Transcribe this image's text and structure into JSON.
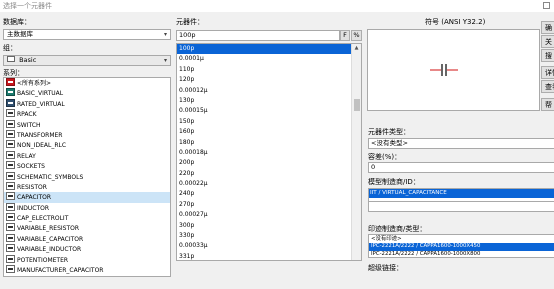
{
  "window": {
    "title": "选择一个元器件"
  },
  "left": {
    "database_label": "数据库：",
    "database_value": "主数据库",
    "group_label": "组：",
    "group_value": "Basic",
    "series_label": "系列：",
    "series": [
      {
        "label": "<所有系列>",
        "icon": "all-series-icon",
        "state": "normal"
      },
      {
        "label": "BASIC_VIRTUAL",
        "icon": "basic-virtual-icon",
        "state": "normal"
      },
      {
        "label": "RATED_VIRTUAL",
        "icon": "rated-virtual-icon",
        "state": "normal"
      },
      {
        "label": "RPACK",
        "icon": "rpack-icon",
        "state": "normal"
      },
      {
        "label": "SWITCH",
        "icon": "switch-icon",
        "state": "normal"
      },
      {
        "label": "TRANSFORMER",
        "icon": "transformer-icon",
        "state": "normal"
      },
      {
        "label": "NON_IDEAL_RLC",
        "icon": "non-ideal-rlc-icon",
        "state": "normal"
      },
      {
        "label": "RELAY",
        "icon": "relay-icon",
        "state": "normal"
      },
      {
        "label": "SOCKETS",
        "icon": "sockets-icon",
        "state": "normal"
      },
      {
        "label": "SCHEMATIC_SYMBOLS",
        "icon": "schematic-symbols-icon",
        "state": "normal"
      },
      {
        "label": "RESISTOR",
        "icon": "resistor-icon",
        "state": "normal"
      },
      {
        "label": "CAPACITOR",
        "icon": "capacitor-icon",
        "state": "selected"
      },
      {
        "label": "INDUCTOR",
        "icon": "inductor-icon",
        "state": "normal"
      },
      {
        "label": "CAP_ELECTROLIT",
        "icon": "cap-electrolit-icon",
        "state": "normal"
      },
      {
        "label": "VARIABLE_RESISTOR",
        "icon": "variable-resistor-icon",
        "state": "normal"
      },
      {
        "label": "VARIABLE_CAPACITOR",
        "icon": "variable-capacitor-icon",
        "state": "normal"
      },
      {
        "label": "VARIABLE_INDUCTOR",
        "icon": "variable-inductor-icon",
        "state": "normal"
      },
      {
        "label": "POTENTIOMETER",
        "icon": "potentiometer-icon",
        "state": "normal"
      },
      {
        "label": "MANUFACTURER_CAPACITOR",
        "icon": "manufacturer-capacitor-icon",
        "state": "normal"
      }
    ]
  },
  "middle": {
    "component_label": "元器件：",
    "search_value": "100p",
    "filter_f": "F",
    "filter_pct": "%",
    "components": [
      "100p",
      "0.0001µ",
      "110p",
      "120p",
      "0.00012µ",
      "130p",
      "0.00015µ",
      "150p",
      "160p",
      "180p",
      "0.00018µ",
      "200p",
      "220p",
      "0.00022µ",
      "240p",
      "270p",
      "0.00027µ",
      "300p",
      "330p",
      "0.00033µ",
      "331p"
    ],
    "selected_index": 0
  },
  "right": {
    "symbol_label": "符号 (ANSI Y32.2)",
    "component_type_label": "元器件类型：",
    "component_type_value": "<没有类型>",
    "tolerance_label": "容差(%)：",
    "tolerance_value": "0",
    "model_mfr_label": "模型制造商/ID：",
    "model_mfr_items": [
      "IIT / VIRTUAL_CAPACITANCE"
    ],
    "footprint_mfr_label": "印迹制造商/类型：",
    "footprint_items": [
      {
        "label": "<没有印迹>",
        "state": "normal"
      },
      {
        "label": "IPC-2221A/2222 / CAPPA1600-1000X450",
        "state": "highlighted"
      },
      {
        "label": "IPC-2221A/2222 / CAPPA1600-1000X800",
        "state": "normal"
      }
    ],
    "hyperlink_label": "超级链接："
  },
  "side_buttons": [
    "确",
    "关",
    "搜",
    "详情",
    "查看",
    "帮"
  ]
}
